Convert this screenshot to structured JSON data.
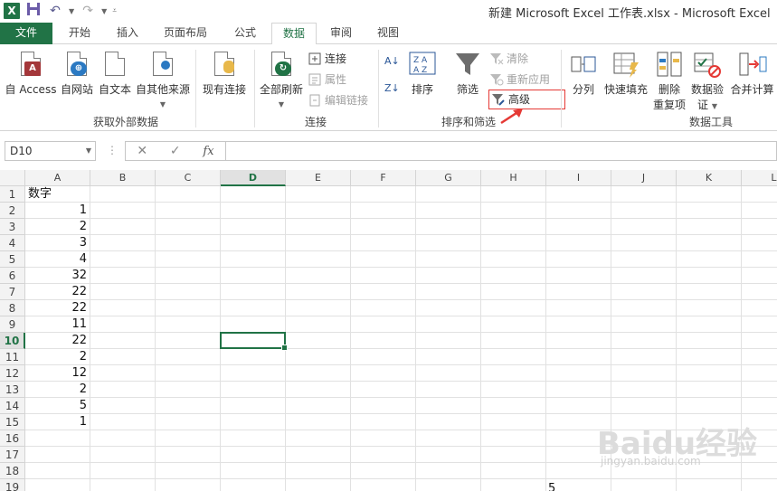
{
  "window": {
    "title": "新建 Microsoft Excel 工作表.xlsx - Microsoft Excel"
  },
  "tabs": [
    {
      "label": "文件"
    },
    {
      "label": "开始"
    },
    {
      "label": "插入"
    },
    {
      "label": "页面布局"
    },
    {
      "label": "公式"
    },
    {
      "label": "数据"
    },
    {
      "label": "审阅"
    },
    {
      "label": "视图"
    }
  ],
  "ribbon": {
    "groups": {
      "external": "获取外部数据",
      "connections": "连接",
      "sort_filter": "排序和筛选",
      "tools": "数据工具"
    },
    "buttons": {
      "from_access": "自 Access",
      "from_web": "自网站",
      "from_text": "自文本",
      "from_other": "自其他来源",
      "existing": "现有连接",
      "refresh_all": "全部刷新",
      "connections": "连接",
      "properties": "属性",
      "edit_links": "编辑链接",
      "sort": "排序",
      "filter": "筛选",
      "clear": "清除",
      "reapply": "重新应用",
      "advanced": "高级",
      "text_to_columns": "分列",
      "flash_fill": "快速填充",
      "remove_dup_1": "删除",
      "remove_dup_2": "重复项",
      "validation_1": "数据验",
      "validation_2": "证",
      "consolidate": "合并计算"
    },
    "colors": {
      "accent": "#217346",
      "highlight": "#e53935"
    }
  },
  "formula_bar": {
    "name_box": "D10",
    "fx_label": "fx",
    "content": ""
  },
  "sheet": {
    "columns": [
      "A",
      "B",
      "C",
      "D",
      "E",
      "F",
      "G",
      "H",
      "I",
      "J",
      "K",
      "L"
    ],
    "selected_column": "D",
    "rows": [
      "1",
      "2",
      "3",
      "4",
      "5",
      "6",
      "7",
      "8",
      "9",
      "10",
      "11",
      "12",
      "13",
      "14",
      "15",
      "16",
      "17",
      "18",
      "19"
    ],
    "selected_row": "10",
    "column_a": [
      "数字",
      "1",
      "2",
      "3",
      "4",
      "32",
      "22",
      "22",
      "11",
      "22",
      "2",
      "12",
      "2",
      "5",
      "1"
    ],
    "extra_cell": "5"
  },
  "watermark": {
    "main": "Baidu经验",
    "sub": "jingyan.baidu.com"
  }
}
